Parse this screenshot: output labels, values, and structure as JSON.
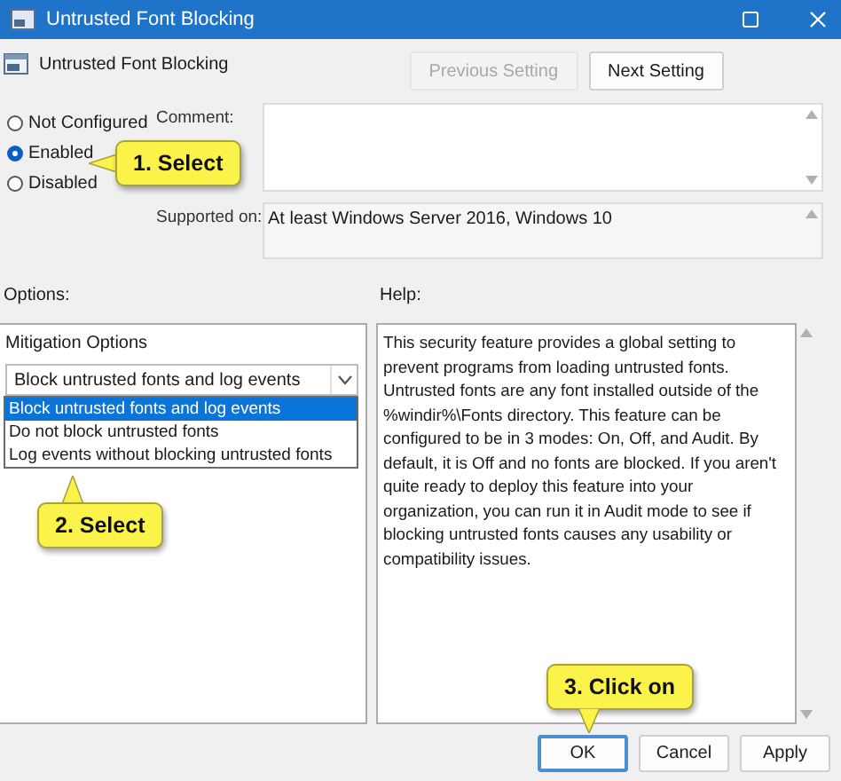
{
  "window": {
    "title": "Untrusted Font Blocking"
  },
  "policy_title": "Untrusted Font Blocking",
  "nav_buttons": [
    {
      "label": "Previous Setting",
      "disabled": true
    },
    {
      "label": "Next Setting",
      "disabled": false
    }
  ],
  "state_options": [
    {
      "label": "Not Configured",
      "selected": false
    },
    {
      "label": "Enabled",
      "selected": true
    },
    {
      "label": "Disabled",
      "selected": false
    }
  ],
  "comment": {
    "label": "Comment:"
  },
  "supported_on": {
    "label": "Supported on:",
    "value": "At least Windows Server 2016, Windows 10"
  },
  "options": {
    "label": "Options:",
    "group_label": "Mitigation Options",
    "dropdown": {
      "value": "Block untrusted fonts and log events",
      "expanded": true,
      "items": [
        {
          "label": "Block untrusted fonts and log events",
          "selected": true
        },
        {
          "label": "Do not block untrusted fonts",
          "selected": false
        },
        {
          "label": "Log events without blocking untrusted fonts",
          "selected": false
        }
      ]
    }
  },
  "help": {
    "label": "Help:",
    "text": "This security feature provides a global setting to prevent programs from loading untrusted fonts. Untrusted fonts are any font installed outside of the %windir%\\Fonts directory. This feature can be configured to be in 3 modes: On, Off, and Audit. By default, it is Off and no fonts are blocked. If you aren't quite ready to deploy this feature into your organization, you can run it in Audit mode to see if blocking untrusted fonts causes any usability or compatibility issues."
  },
  "buttons": [
    {
      "label": "OK",
      "focused": true
    },
    {
      "label": "Cancel",
      "focused": false
    },
    {
      "label": "Apply",
      "focused": false
    }
  ],
  "callouts": [
    {
      "text": "1. Select",
      "kind": "left"
    },
    {
      "text": "2. Select",
      "kind": "up"
    },
    {
      "text": "3. Click on",
      "kind": "down"
    }
  ]
}
